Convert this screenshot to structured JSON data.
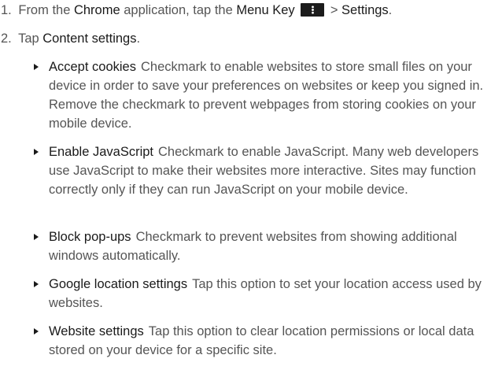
{
  "steps": [
    {
      "num": "1.",
      "pre": "From the ",
      "app": "Chrome",
      "mid": " application, tap the ",
      "key": "Menu Key",
      "after_key": " > ",
      "dest": "Settings",
      "end": "."
    },
    {
      "num": "2.",
      "pre": "Tap ",
      "dest": "Content settings",
      "end": "."
    }
  ],
  "bullets": [
    {
      "title": "Accept cookies",
      "desc": "Checkmark to enable websites to store small files on your device in order to save your preferences on websites or keep you signed in. Remove the checkmark to prevent webpages from storing cookies on your mobile device."
    },
    {
      "title": "Enable JavaScript",
      "desc": "Checkmark to enable JavaScript. Many web developers use JavaScript to make their websites more interactive. Sites may function correctly only if they can run JavaScript on your mobile device."
    },
    {
      "title": "Block pop-ups",
      "desc": "Checkmark to prevent websites from showing additional windows automatically."
    },
    {
      "title": "Google location settings",
      "desc": "Tap this option to set your location access used by websites."
    },
    {
      "title": "Website settings",
      "desc": "Tap this option to clear location permissions or local data stored on your device for a specific site."
    }
  ],
  "icons": {
    "menu_key": "menu-key-icon",
    "bullet": "triangle-bullet-icon"
  }
}
